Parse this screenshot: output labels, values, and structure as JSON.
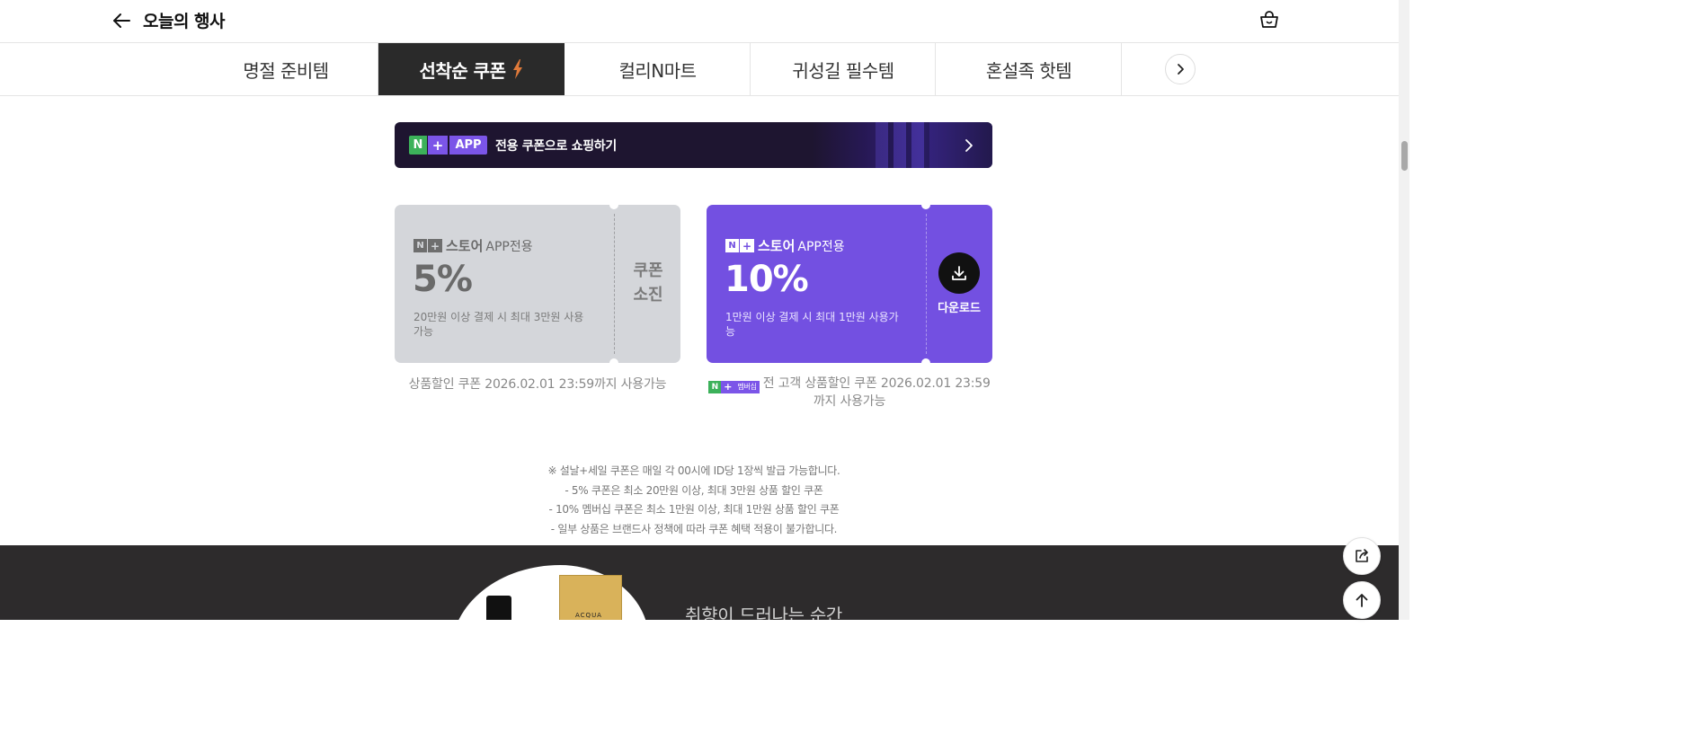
{
  "header": {
    "title": "오늘의 행사"
  },
  "tabs": [
    {
      "label": "명절 준비템"
    },
    {
      "label": "선착순 쿠폰"
    },
    {
      "label": "컬리N마트"
    },
    {
      "label": "귀성길 필수템"
    },
    {
      "label": "혼설족 핫템"
    }
  ],
  "banner": {
    "badge_n": "N",
    "badge_plus": "+",
    "badge_app": "APP",
    "text": "전용 쿠폰으로 쇼핑하기"
  },
  "coupons": [
    {
      "mini_n": "N",
      "mini_plus": "+",
      "store": "스토어",
      "app_only": "APP전용",
      "percent": "5%",
      "condition": "20만원 이상 결제 시 최대 3만원 사용가능",
      "status_line1": "쿠폰",
      "status_line2": "소진",
      "note": "상품할인 쿠폰 2026.02.01 23:59까지 사용가능"
    },
    {
      "mini_n": "N",
      "mini_plus": "+",
      "store": "스토어",
      "app_only": "APP전용",
      "percent": "10%",
      "condition": "1만원 이상 결제 시 최대 1만원 사용가능",
      "download_label": "다운로드",
      "badge_n": "N",
      "badge_plus": "+",
      "badge_membership": "멤버십",
      "note": "전 고객 상품할인 쿠폰 2026.02.01 23:59까지 사용가능"
    }
  ],
  "notice": [
    "※ 설날+세일 쿠폰은 매일 각 00시에 ID당 1장씩 발급 가능합니다.",
    "- 5% 쿠폰은 최소 20만원 이상, 최대 3만원 상품 할인 쿠폰",
    "- 10% 멤버십 쿠폰은 최소 1만원 이상, 최대 1만원 상품 할인 쿠폰",
    "- 일부 상품은 브랜드사 정책에 따라 쿠폰 혜택 적용이 불가합니다."
  ],
  "promo": {
    "bag_label": "ACQUA",
    "text": "취향이 드러나는 순간"
  },
  "colors": {
    "accent": "#7350e1",
    "active_tab": "#2a2a2a",
    "banner_bg": "#1e1530",
    "bolt": "#e07a3a",
    "green": "#3cb15a"
  }
}
